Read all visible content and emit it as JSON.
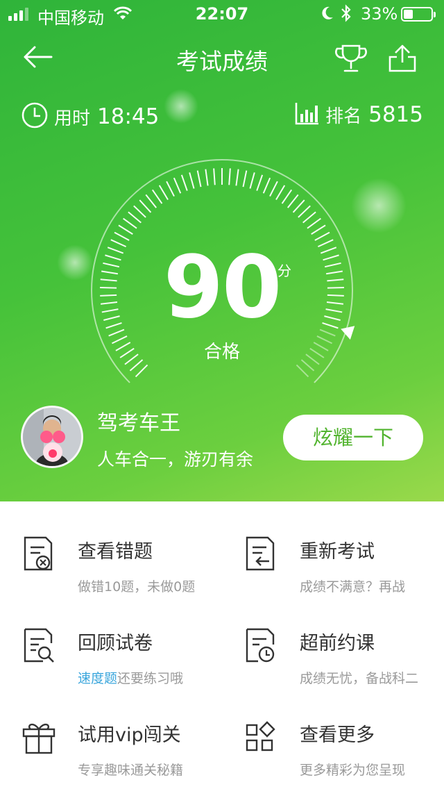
{
  "status_bar": {
    "carrier": "中国移动",
    "time": "22:07",
    "battery_percent": "33%",
    "battery_level": 0.33,
    "icons": [
      "signal-icon",
      "wifi-icon",
      "moon-icon",
      "bluetooth-icon",
      "battery-icon"
    ]
  },
  "nav": {
    "title": "考试成绩",
    "back_icon": "back-arrow-icon",
    "trophy_icon": "trophy-icon",
    "share_icon": "share-icon"
  },
  "stats": {
    "time_label": "用时",
    "time_value": "18:45",
    "rank_label": "排名",
    "rank_value": "5815"
  },
  "result": {
    "score": "90",
    "score_unit": "分",
    "score_max": 100,
    "status": "合格"
  },
  "user": {
    "title": "驾考车王",
    "subtitle": "人车合一，游刃有余",
    "button_label": "炫耀一下"
  },
  "menu": {
    "items": [
      {
        "title": "查看错题",
        "desc": "做错10题，未做0题",
        "icon": "wrong-questions-icon"
      },
      {
        "title": "重新考试",
        "desc": "成绩不满意？再战",
        "icon": "retake-exam-icon"
      },
      {
        "title": "回顾试卷",
        "desc_highlight": "速度题",
        "desc": "还要练习哦",
        "icon": "review-paper-icon"
      },
      {
        "title": "超前约课",
        "desc": "成绩无忧，备战科二",
        "icon": "book-lesson-icon"
      },
      {
        "title": "试用vip闯关",
        "desc": "专享趣味通关秘籍",
        "icon": "gift-icon"
      },
      {
        "title": "查看更多",
        "desc": "更多精彩为您呈现",
        "icon": "more-apps-icon"
      }
    ]
  },
  "colors": {
    "green_dark": "#2fb43a",
    "green_light": "#9ad94b",
    "button_text": "#52b42f",
    "highlight": "#3aa6dc"
  }
}
